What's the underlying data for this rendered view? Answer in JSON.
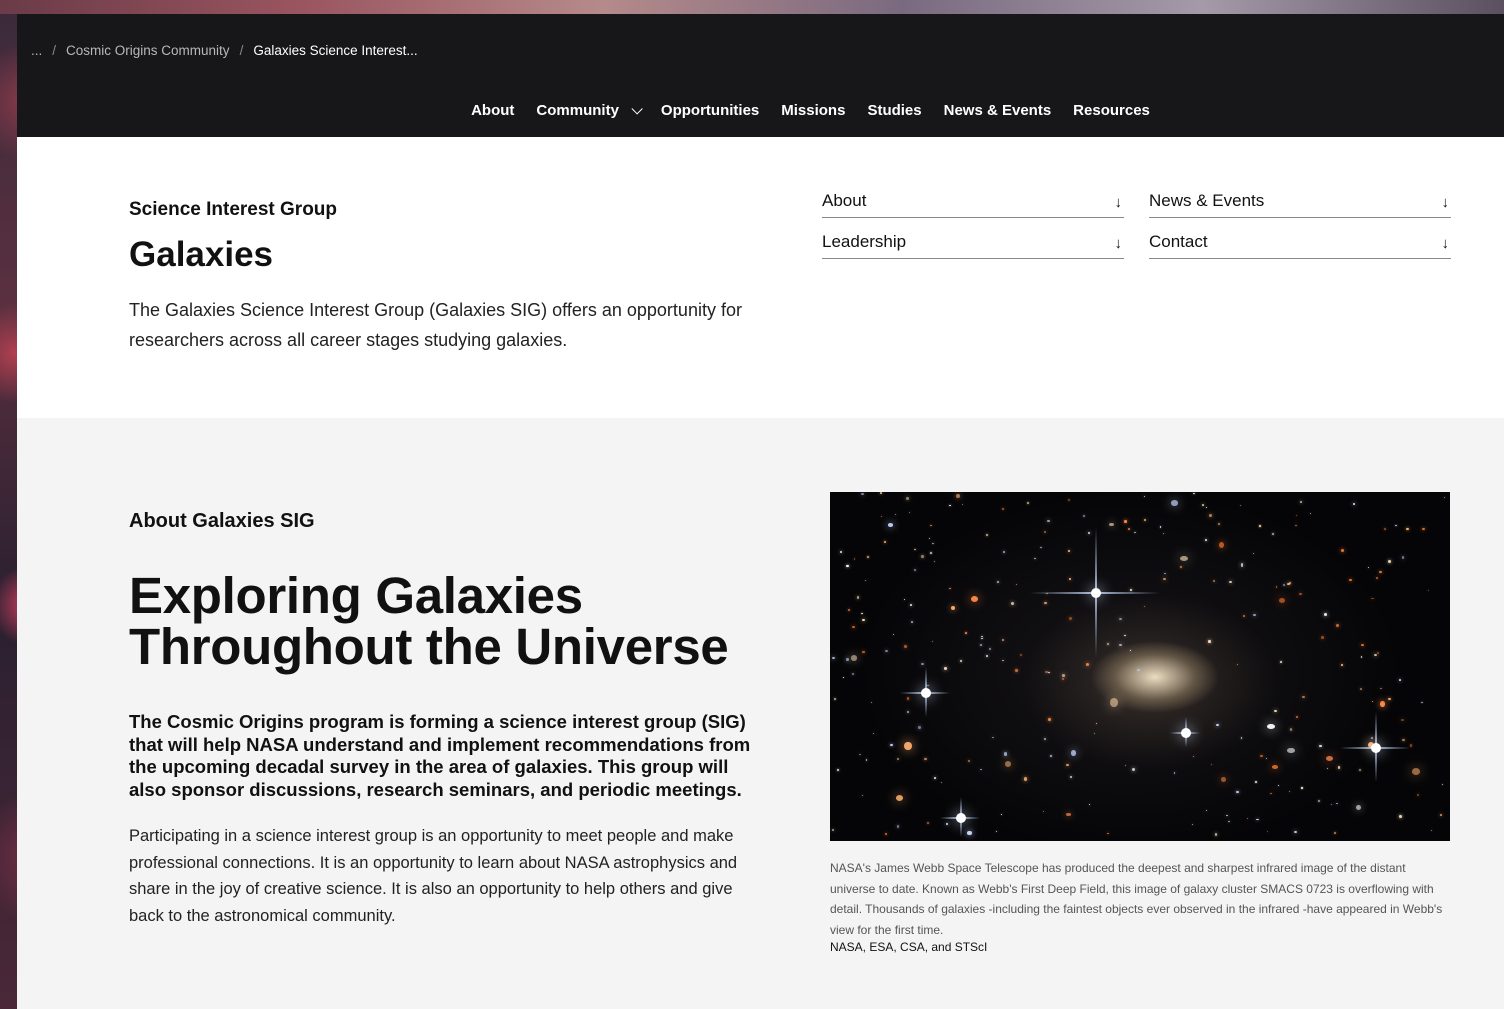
{
  "breadcrumb": {
    "ellipsis": "...",
    "parent": "Cosmic Origins Community",
    "current": "Galaxies Science Interest..."
  },
  "nav": {
    "items": [
      "About",
      "Community",
      "Opportunities",
      "Missions",
      "Studies",
      "News & Events",
      "Resources"
    ]
  },
  "hero": {
    "eyebrow": "Science Interest Group",
    "title": "Galaxies",
    "lede": "The Galaxies Science Interest Group (Galaxies SIG) offers an opportunity for researchers across all career stages studying galaxies.",
    "jump_links": [
      "About",
      "News & Events",
      "Leadership",
      "Contact"
    ],
    "jump_arrow": "↓"
  },
  "about": {
    "eyebrow": "About Galaxies SIG",
    "headline": "Exploring Galaxies Throughout the Universe",
    "strong": "The Cosmic Origins program is forming a science interest group (SIG) that will help NASA understand and implement recommendations from the upcoming decadal survey in the area of galaxies. This group will also sponsor discussions, research seminars, and periodic meetings.",
    "body": "Participating in a science interest group is an opportunity to meet people and make professional connections. It is an opportunity to learn about NASA astrophysics and share in the joy of creative science. It is also an opportunity to help others and give back to the astronomical community.",
    "caption": "NASA's James Webb Space Telescope has produced the deepest and sharpest infrared image of the distant universe to date. Known as Webb's First Deep Field, this image of galaxy cluster SMACS 0723 is overflowing with detail. Thousands of galaxies -including the faintest objects ever observed in the infrared -have appeared in Webb's view for the first time.",
    "credit": "NASA, ESA, CSA, and STScI"
  }
}
